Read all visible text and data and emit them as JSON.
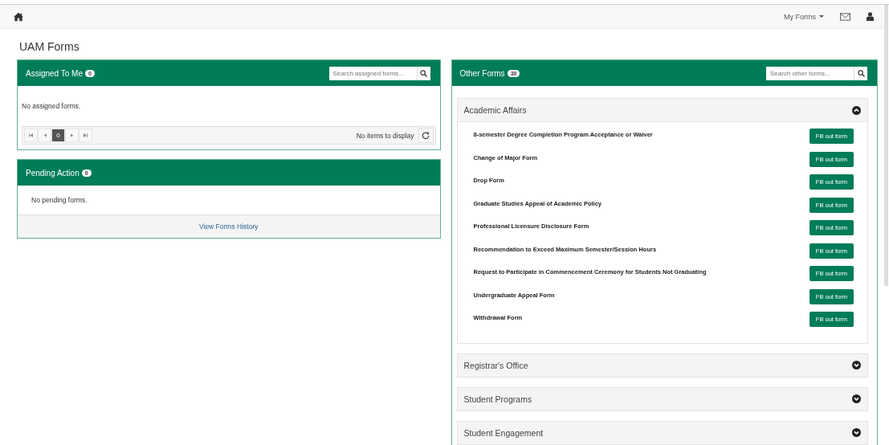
{
  "navbar": {
    "menu_label": "My Forms"
  },
  "page_title": "UAM Forms",
  "assigned": {
    "title": "Assigned To Me",
    "count": "0",
    "search": {
      "placeholder": "Search assigned forms..."
    },
    "empty_text": "No assigned forms.",
    "pager": {
      "pages": [
        {
          "label": "0",
          "selected": true
        }
      ],
      "status": "No items to display"
    }
  },
  "pending": {
    "title": "Pending Action",
    "count": "0",
    "empty_text": "No pending forms.",
    "footer_link": "View Forms History"
  },
  "other": {
    "title": "Other Forms",
    "count": "30",
    "search": {
      "placeholder": "Search other forms..."
    },
    "sections": [
      {
        "title": "Academic Affairs",
        "expanded": true,
        "forms": [
          {
            "name": "8-semester Degree Completion Program Acceptance or Waiver",
            "action": "Fill out form"
          },
          {
            "name": "Change of Major Form",
            "action": "Fill out form"
          },
          {
            "name": "Drop Form",
            "action": "Fill out form"
          },
          {
            "name": "Graduate Studies Appeal of Academic Policy",
            "action": "Fill out form"
          },
          {
            "name": "Professional Licensure Disclosure Form",
            "action": "Fill out form"
          },
          {
            "name": "Recommendation to Exceed Maximum Semester/Session Hours",
            "action": "Fill out form"
          },
          {
            "name": "Request to Participate in Commencement Ceremony for Students Not Graduating",
            "action": "Fill out form"
          },
          {
            "name": "Undergraduate Appeal Form",
            "action": "Fill out form"
          },
          {
            "name": "Withdrawal Form",
            "action": "Fill out form"
          }
        ]
      },
      {
        "title": "Registrar's Office",
        "expanded": false
      },
      {
        "title": "Student Programs",
        "expanded": false
      },
      {
        "title": "Student Engagement",
        "expanded": false
      }
    ]
  }
}
